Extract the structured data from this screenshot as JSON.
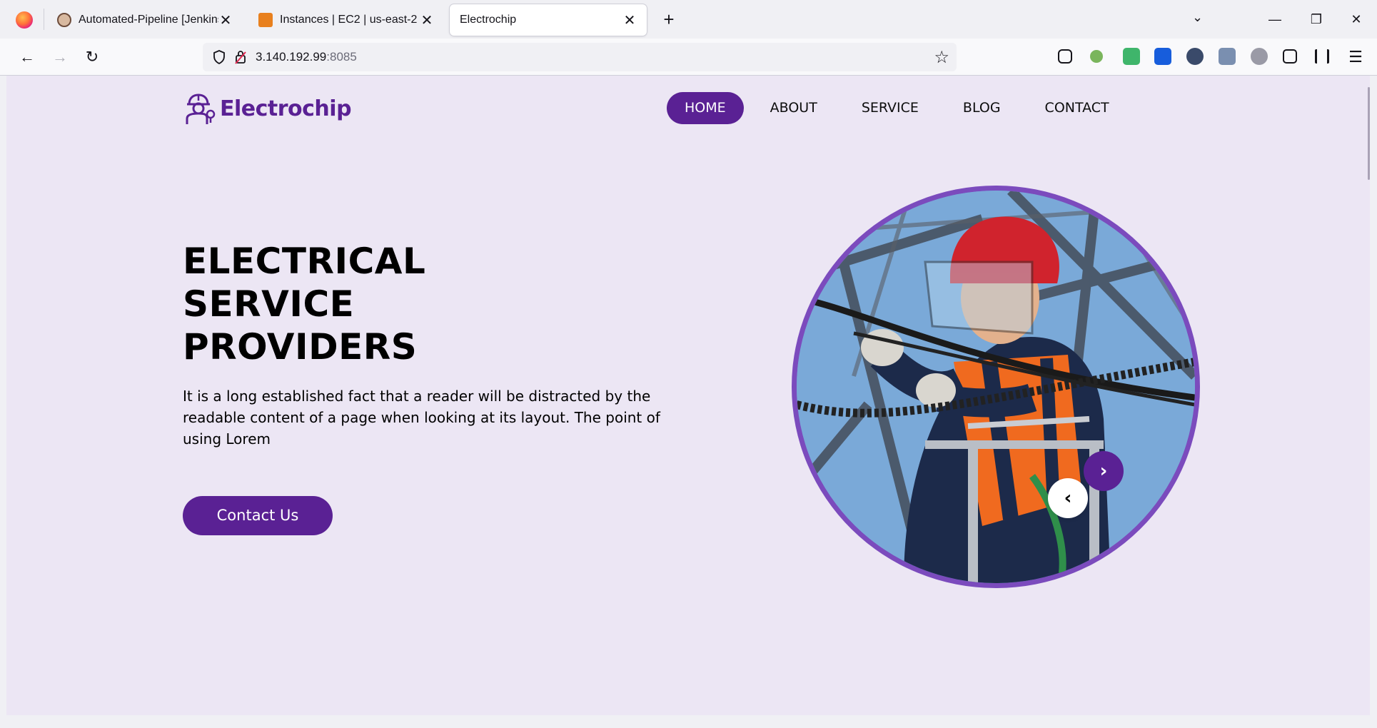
{
  "browser": {
    "tabs": [
      {
        "title": "Automated-Pipeline [Jenkins]",
        "favicon": "jenkins-icon",
        "active": false
      },
      {
        "title": "Instances | EC2 | us-east-2",
        "favicon": "aws-icon",
        "active": false
      },
      {
        "title": "Electrochip",
        "favicon": "",
        "active": true
      }
    ],
    "url_host": "3.140.192.99",
    "url_port": ":8085",
    "close_glyph": "✕",
    "newtab_glyph": "+",
    "list_tabs_glyph": "⌄",
    "window_controls": {
      "minimize": "—",
      "restore": "❐",
      "close": "✕"
    },
    "nav": {
      "back": "←",
      "forward": "→",
      "reload": "↻",
      "bookmark": "☆",
      "menu": "☰"
    }
  },
  "site": {
    "brand": "Electrochip",
    "brand_color": "#5a2194",
    "menu": [
      {
        "label": "HOME",
        "active": true
      },
      {
        "label": "ABOUT",
        "active": false
      },
      {
        "label": "SERVICE",
        "active": false
      },
      {
        "label": "BLOG",
        "active": false
      },
      {
        "label": "CONTACT",
        "active": false
      }
    ],
    "hero": {
      "title_lines": [
        "ELECTRICAL",
        "SERVICE",
        "PROVIDERS"
      ],
      "text": "It is a long established fact that a reader will be distracted by the readable content of a page when looking at its layout. The point of using Lorem",
      "cta": "Contact Us"
    },
    "slider": {
      "next": "›",
      "prev": "‹"
    },
    "background": "#ece6f4"
  }
}
